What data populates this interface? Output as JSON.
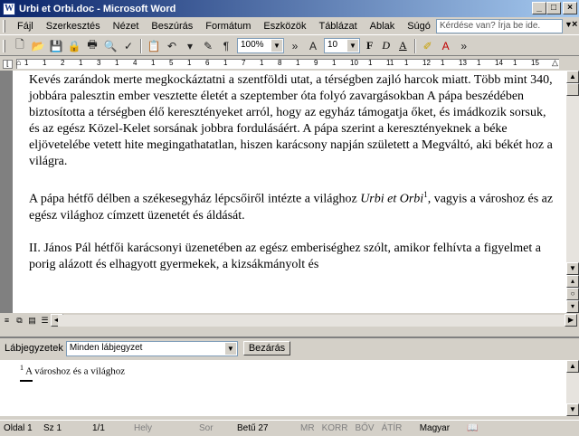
{
  "window": {
    "title": "Urbi et Orbi.doc - Microsoft Word"
  },
  "menu": [
    {
      "label": "Fájl"
    },
    {
      "label": "Szerkesztés"
    },
    {
      "label": "Nézet"
    },
    {
      "label": "Beszúrás"
    },
    {
      "label": "Formátum"
    },
    {
      "label": "Eszközök"
    },
    {
      "label": "Táblázat"
    },
    {
      "label": "Ablak"
    },
    {
      "label": "Súgó"
    }
  ],
  "help_placeholder": "Kérdése van? Írja be ide.",
  "toolbar": {
    "zoom": "100%",
    "font_size": "10",
    "bold": "F",
    "italic": "D",
    "underline": "A"
  },
  "ruler": {
    "numbers": [
      "1",
      "1",
      "2",
      "1",
      "3",
      "1",
      "4",
      "1",
      "5",
      "1",
      "6",
      "1",
      "7",
      "1",
      "8",
      "1",
      "9",
      "1",
      "10",
      "1",
      "11",
      "1",
      "12",
      "1",
      "13",
      "1",
      "14",
      "1",
      "15"
    ]
  },
  "document": {
    "para1": "Kevés zarándok merte megkockáztatni a szentföldi utat, a térségben zajló harcok miatt. Több mint 340, jobbára palesztin ember vesztette életét a szeptember óta folyó zavargásokban A pápa beszédében biztosította a térségben élő keresztényeket arról, hogy az egyház támogatja őket, és imádkozik sorsuk, és az egész Közel-Kelet sorsának jobbra fordulásáért. A pápa szerint a keresztényeknek a béke eljövetelébe vetett hite megingathatatlan, hiszen karácsony napján született a Megváltó, aki békét hoz a világra.",
    "para2_a": "A pápa hétfő délben a székesegyház lépcsőiről intézte a világhoz ",
    "para2_em": "Urbi et Orbi",
    "para2_ref": "1",
    "para2_b": ", vagyis a városhoz és az egész világhoz címzett üzenetét és áldását.",
    "para3": "II. János Pál hétfői karácsonyi üzenetében az egész emberiséghez szólt, amikor felhívta a figyelmet a porig alázott és elhagyott gyermekek, a kizsákmányolt és"
  },
  "footnote": {
    "label": "Lábjegyzetek",
    "select_value": "Minden lábjegyzet",
    "close_label": "Bezárás",
    "ref": "1",
    "text": " A városhoz és a világhoz"
  },
  "status": {
    "page": "Oldal 1",
    "section": "Sz 1",
    "pages": "1/1",
    "at": "Hely",
    "line": "Sor",
    "col": "Betű 27",
    "rec": "MR",
    "trk": "KORR",
    "ext": "BŐV",
    "ovr": "ÁTÍR",
    "lang": "Magyar"
  }
}
